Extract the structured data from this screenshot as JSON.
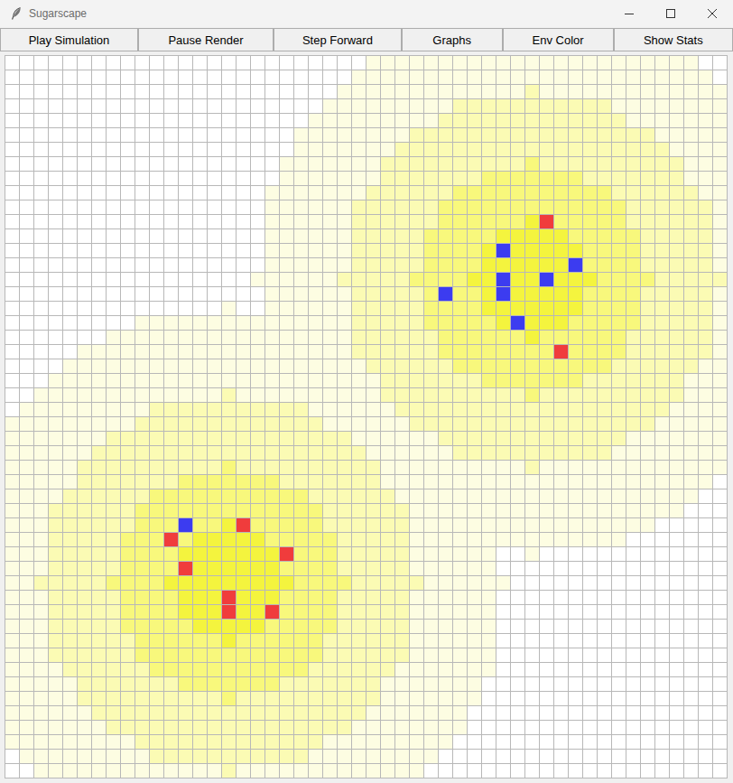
{
  "window": {
    "title": "Sugarscape"
  },
  "toolbar": [
    {
      "label": "Play Simulation"
    },
    {
      "label": "Pause Render"
    },
    {
      "label": "Step Forward"
    },
    {
      "label": "Graphs"
    },
    {
      "label": "Env Color"
    },
    {
      "label": "Show Stats"
    }
  ],
  "sugar": {
    "rows": [
      [
        [
          0,
          25
        ],
        [
          1,
          23
        ],
        [
          0,
          2
        ]
      ],
      [
        [
          0,
          24
        ],
        [
          1,
          25
        ],
        [
          0,
          1
        ]
      ],
      [
        [
          0,
          23
        ],
        [
          1,
          13
        ],
        [
          2,
          1
        ],
        [
          1,
          13
        ]
      ],
      [
        [
          0,
          22
        ],
        [
          1,
          9
        ],
        [
          2,
          11
        ],
        [
          1,
          8
        ]
      ],
      [
        [
          0,
          21
        ],
        [
          1,
          9
        ],
        [
          2,
          13
        ],
        [
          1,
          7
        ]
      ],
      [
        [
          0,
          20
        ],
        [
          1,
          8
        ],
        [
          2,
          17
        ],
        [
          1,
          5
        ]
      ],
      [
        [
          0,
          20
        ],
        [
          1,
          7
        ],
        [
          2,
          19
        ],
        [
          1,
          4
        ]
      ],
      [
        [
          0,
          19
        ],
        [
          1,
          7
        ],
        [
          2,
          10
        ],
        [
          3,
          1
        ],
        [
          2,
          10
        ],
        [
          1,
          3
        ]
      ],
      [
        [
          0,
          19
        ],
        [
          1,
          7
        ],
        [
          2,
          7
        ],
        [
          3,
          7
        ],
        [
          2,
          7
        ],
        [
          1,
          3
        ]
      ],
      [
        [
          0,
          18
        ],
        [
          1,
          7
        ],
        [
          2,
          6
        ],
        [
          3,
          11
        ],
        [
          2,
          6
        ],
        [
          1,
          2
        ]
      ],
      [
        [
          0,
          18
        ],
        [
          1,
          6
        ],
        [
          2,
          6
        ],
        [
          3,
          13
        ],
        [
          2,
          6
        ],
        [
          1,
          1
        ]
      ],
      [
        [
          0,
          18
        ],
        [
          1,
          6
        ],
        [
          2,
          6
        ],
        [
          3,
          6
        ],
        [
          4,
          1
        ],
        [
          3,
          6
        ],
        [
          2,
          6
        ],
        [
          1,
          1
        ]
      ],
      [
        [
          0,
          18
        ],
        [
          1,
          6
        ],
        [
          2,
          5
        ],
        [
          3,
          5
        ],
        [
          4,
          5
        ],
        [
          3,
          5
        ],
        [
          2,
          5
        ],
        [
          1,
          1
        ]
      ],
      [
        [
          0,
          18
        ],
        [
          1,
          6
        ],
        [
          2,
          5
        ],
        [
          3,
          4
        ],
        [
          4,
          7
        ],
        [
          3,
          4
        ],
        [
          2,
          5
        ],
        [
          1,
          1
        ]
      ],
      [
        [
          0,
          18
        ],
        [
          1,
          6
        ],
        [
          2,
          5
        ],
        [
          3,
          4
        ],
        [
          4,
          7
        ],
        [
          3,
          4
        ],
        [
          2,
          5
        ],
        [
          1,
          1
        ]
      ],
      [
        [
          0,
          17
        ],
        [
          1,
          6
        ],
        [
          2,
          5
        ],
        [
          3,
          4
        ],
        [
          4,
          9
        ],
        [
          3,
          4
        ],
        [
          2,
          5
        ]
      ],
      [
        [
          0,
          18
        ],
        [
          1,
          6
        ],
        [
          2,
          5
        ],
        [
          3,
          4
        ],
        [
          4,
          7
        ],
        [
          3,
          4
        ],
        [
          2,
          5
        ],
        [
          1,
          1
        ]
      ],
      [
        [
          0,
          15
        ],
        [
          1,
          1
        ],
        [
          0,
          2
        ],
        [
          1,
          6
        ],
        [
          2,
          5
        ],
        [
          3,
          4
        ],
        [
          4,
          7
        ],
        [
          3,
          4
        ],
        [
          2,
          5
        ],
        [
          1,
          1
        ]
      ],
      [
        [
          0,
          9
        ],
        [
          1,
          15
        ],
        [
          2,
          5
        ],
        [
          3,
          5
        ],
        [
          4,
          5
        ],
        [
          3,
          5
        ],
        [
          2,
          5
        ],
        [
          1,
          1
        ]
      ],
      [
        [
          0,
          7
        ],
        [
          1,
          17
        ],
        [
          2,
          6
        ],
        [
          3,
          6
        ],
        [
          4,
          1
        ],
        [
          3,
          6
        ],
        [
          2,
          6
        ],
        [
          1,
          1
        ]
      ],
      [
        [
          0,
          5
        ],
        [
          1,
          19
        ],
        [
          2,
          6
        ],
        [
          3,
          13
        ],
        [
          2,
          6
        ],
        [
          1,
          1
        ]
      ],
      [
        [
          0,
          4
        ],
        [
          1,
          21
        ],
        [
          2,
          6
        ],
        [
          3,
          11
        ],
        [
          2,
          6
        ],
        [
          1,
          2
        ]
      ],
      [
        [
          0,
          3
        ],
        [
          1,
          23
        ],
        [
          2,
          7
        ],
        [
          3,
          7
        ],
        [
          2,
          7
        ],
        [
          1,
          3
        ]
      ],
      [
        [
          0,
          2
        ],
        [
          1,
          13
        ],
        [
          2,
          1
        ],
        [
          1,
          10
        ],
        [
          2,
          10
        ],
        [
          3,
          1
        ],
        [
          2,
          10
        ],
        [
          1,
          3
        ]
      ],
      [
        [
          0,
          1
        ],
        [
          1,
          9
        ],
        [
          2,
          11
        ],
        [
          1,
          6
        ],
        [
          2,
          19
        ],
        [
          1,
          4
        ]
      ],
      [
        [
          1,
          9
        ],
        [
          2,
          13
        ],
        [
          1,
          6
        ],
        [
          2,
          17
        ],
        [
          1,
          5
        ]
      ],
      [
        [
          1,
          7
        ],
        [
          2,
          17
        ],
        [
          1,
          6
        ],
        [
          2,
          13
        ],
        [
          1,
          7
        ]
      ],
      [
        [
          1,
          6
        ],
        [
          2,
          19
        ],
        [
          1,
          6
        ],
        [
          2,
          11
        ],
        [
          1,
          8
        ]
      ],
      [
        [
          1,
          5
        ],
        [
          2,
          10
        ],
        [
          3,
          1
        ],
        [
          2,
          10
        ],
        [
          1,
          10
        ],
        [
          2,
          1
        ],
        [
          1,
          13
        ]
      ],
      [
        [
          1,
          5
        ],
        [
          2,
          7
        ],
        [
          3,
          7
        ],
        [
          2,
          7
        ],
        [
          1,
          23
        ],
        [
          0,
          1
        ]
      ],
      [
        [
          1,
          4
        ],
        [
          2,
          6
        ],
        [
          3,
          11
        ],
        [
          2,
          6
        ],
        [
          1,
          21
        ],
        [
          0,
          2
        ]
      ],
      [
        [
          1,
          3
        ],
        [
          2,
          6
        ],
        [
          3,
          13
        ],
        [
          2,
          6
        ],
        [
          1,
          19
        ],
        [
          0,
          3
        ]
      ],
      [
        [
          1,
          3
        ],
        [
          2,
          6
        ],
        [
          3,
          6
        ],
        [
          4,
          1
        ],
        [
          3,
          6
        ],
        [
          2,
          6
        ],
        [
          1,
          17
        ],
        [
          0,
          5
        ]
      ],
      [
        [
          1,
          3
        ],
        [
          2,
          5
        ],
        [
          3,
          5
        ],
        [
          4,
          5
        ],
        [
          3,
          5
        ],
        [
          2,
          5
        ],
        [
          1,
          15
        ],
        [
          0,
          7
        ]
      ],
      [
        [
          1,
          3
        ],
        [
          2,
          5
        ],
        [
          3,
          4
        ],
        [
          4,
          7
        ],
        [
          3,
          4
        ],
        [
          2,
          5
        ],
        [
          1,
          6
        ],
        [
          0,
          2
        ],
        [
          1,
          1
        ],
        [
          0,
          13
        ]
      ],
      [
        [
          1,
          3
        ],
        [
          2,
          5
        ],
        [
          3,
          4
        ],
        [
          4,
          7
        ],
        [
          3,
          4
        ],
        [
          2,
          5
        ],
        [
          1,
          6
        ],
        [
          0,
          16
        ]
      ],
      [
        [
          1,
          2
        ],
        [
          2,
          5
        ],
        [
          3,
          4
        ],
        [
          4,
          9
        ],
        [
          3,
          4
        ],
        [
          2,
          5
        ],
        [
          1,
          6
        ],
        [
          0,
          15
        ]
      ],
      [
        [
          1,
          3
        ],
        [
          2,
          5
        ],
        [
          3,
          4
        ],
        [
          4,
          7
        ],
        [
          3,
          4
        ],
        [
          2,
          5
        ],
        [
          1,
          6
        ],
        [
          0,
          16
        ]
      ],
      [
        [
          1,
          3
        ],
        [
          2,
          5
        ],
        [
          3,
          4
        ],
        [
          4,
          7
        ],
        [
          3,
          4
        ],
        [
          2,
          5
        ],
        [
          1,
          6
        ],
        [
          0,
          16
        ]
      ],
      [
        [
          1,
          3
        ],
        [
          2,
          5
        ],
        [
          3,
          5
        ],
        [
          4,
          5
        ],
        [
          3,
          5
        ],
        [
          2,
          5
        ],
        [
          1,
          6
        ],
        [
          0,
          16
        ]
      ],
      [
        [
          1,
          3
        ],
        [
          2,
          6
        ],
        [
          3,
          6
        ],
        [
          4,
          1
        ],
        [
          3,
          6
        ],
        [
          2,
          6
        ],
        [
          1,
          6
        ],
        [
          0,
          16
        ]
      ],
      [
        [
          1,
          3
        ],
        [
          2,
          6
        ],
        [
          3,
          13
        ],
        [
          2,
          6
        ],
        [
          1,
          6
        ],
        [
          0,
          16
        ]
      ],
      [
        [
          1,
          4
        ],
        [
          2,
          6
        ],
        [
          3,
          11
        ],
        [
          2,
          6
        ],
        [
          1,
          7
        ],
        [
          0,
          16
        ]
      ],
      [
        [
          1,
          5
        ],
        [
          2,
          7
        ],
        [
          3,
          7
        ],
        [
          2,
          7
        ],
        [
          1,
          7
        ],
        [
          0,
          17
        ]
      ],
      [
        [
          1,
          5
        ],
        [
          2,
          10
        ],
        [
          3,
          1
        ],
        [
          2,
          10
        ],
        [
          1,
          7
        ],
        [
          0,
          17
        ]
      ],
      [
        [
          1,
          6
        ],
        [
          2,
          19
        ],
        [
          1,
          7
        ],
        [
          0,
          18
        ]
      ],
      [
        [
          1,
          7
        ],
        [
          2,
          17
        ],
        [
          1,
          8
        ],
        [
          0,
          18
        ]
      ],
      [
        [
          1,
          9
        ],
        [
          2,
          13
        ],
        [
          1,
          9
        ],
        [
          0,
          19
        ]
      ],
      [
        [
          0,
          1
        ],
        [
          1,
          9
        ],
        [
          2,
          11
        ],
        [
          1,
          9
        ],
        [
          0,
          20
        ]
      ],
      [
        [
          0,
          2
        ],
        [
          1,
          13
        ],
        [
          2,
          1
        ],
        [
          1,
          13
        ],
        [
          0,
          21
        ]
      ]
    ]
  },
  "agents": [
    {
      "row": 11,
      "col": 37,
      "color": "#f03c3c"
    },
    {
      "row": 13,
      "col": 34,
      "color": "#3c3cf0"
    },
    {
      "row": 14,
      "col": 39,
      "color": "#3c3cf0"
    },
    {
      "row": 15,
      "col": 34,
      "color": "#3c3cf0"
    },
    {
      "row": 15,
      "col": 37,
      "color": "#3c3cf0"
    },
    {
      "row": 16,
      "col": 30,
      "color": "#3c3cf0"
    },
    {
      "row": 16,
      "col": 34,
      "color": "#3c3cf0"
    },
    {
      "row": 18,
      "col": 35,
      "color": "#3c3cf0"
    },
    {
      "row": 20,
      "col": 38,
      "color": "#f03c3c"
    },
    {
      "row": 32,
      "col": 12,
      "color": "#3c3cf0"
    },
    {
      "row": 32,
      "col": 16,
      "color": "#f03c3c"
    },
    {
      "row": 33,
      "col": 11,
      "color": "#f03c3c"
    },
    {
      "row": 34,
      "col": 19,
      "color": "#f03c3c"
    },
    {
      "row": 35,
      "col": 12,
      "color": "#f03c3c"
    },
    {
      "row": 37,
      "col": 15,
      "color": "#f03c3c"
    },
    {
      "row": 38,
      "col": 15,
      "color": "#f03c3c"
    },
    {
      "row": 38,
      "col": 18,
      "color": "#f03c3c"
    }
  ]
}
